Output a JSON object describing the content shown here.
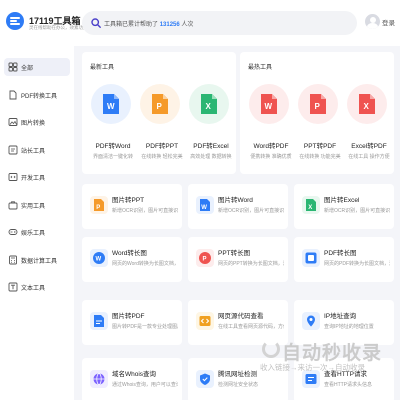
{
  "header": {
    "logo_title": "17119工具箱",
    "logo_sub": "灵在线帮助在办公，效素功搜",
    "search_prefix": "工具箱已累计帮助了",
    "search_count": "131256",
    "search_suffix": "人次",
    "login_label": "登录"
  },
  "sidebar": {
    "items": [
      {
        "label": "全部",
        "icon": "grid-icon"
      },
      {
        "label": "PDF转换工具",
        "icon": "document-icon"
      },
      {
        "label": "图片转换",
        "icon": "image-icon"
      },
      {
        "label": "站长工具",
        "icon": "tools-icon"
      },
      {
        "label": "开发工具",
        "icon": "code-icon"
      },
      {
        "label": "实用工具",
        "icon": "briefcase-icon"
      },
      {
        "label": "娱乐工具",
        "icon": "game-icon"
      },
      {
        "label": "数据计算工具",
        "icon": "calculator-icon"
      },
      {
        "label": "文本工具",
        "icon": "text-icon"
      }
    ]
  },
  "latest": {
    "title": "最新工具",
    "tools": [
      {
        "name": "PDF转Word",
        "desc": "界面清洁一键化转",
        "color": "#2e7cf6",
        "bg": "#e9f1fe",
        "letter": "W"
      },
      {
        "name": "PDF转PPT",
        "desc": "在线转换 轻松完美",
        "color": "#f59a2a",
        "bg": "#fef3e6",
        "letter": "P"
      },
      {
        "name": "PDF转Excel",
        "desc": "高效处理 数据转换",
        "color": "#2bb673",
        "bg": "#e8f7ef",
        "letter": "X"
      }
    ]
  },
  "hot": {
    "title": "最热工具",
    "tools": [
      {
        "name": "Word转PDF",
        "desc": "便携转换 准确优质",
        "color": "#ef5350",
        "bg": "#fdecec",
        "letter": "W"
      },
      {
        "name": "PPT转PDF",
        "desc": "在线转换 功能完美",
        "color": "#ef5350",
        "bg": "#fdecec",
        "letter": "P"
      },
      {
        "name": "Excel转PDF",
        "desc": "在线工具 操作方便",
        "color": "#ef5350",
        "bg": "#fdecec",
        "letter": "X"
      }
    ]
  },
  "cards": [
    {
      "title": "图片转PPT",
      "desc": "新增OCR识别，图片可直接识别",
      "color": "#f59a2a",
      "glyph": "P"
    },
    {
      "title": "图片转Word",
      "desc": "新增OCR识别，图片可直接识别",
      "color": "#2e7cf6",
      "glyph": "W"
    },
    {
      "title": "图片转Excel",
      "desc": "新增OCR识别，图片可直接识别",
      "color": "#2bb673",
      "glyph": "X"
    },
    {
      "title": "Word转长图",
      "desc": "网页的Word转换为长图文档，清晰",
      "color": "#2e7cf6",
      "glyph": "W"
    },
    {
      "title": "PPT转长图",
      "desc": "网页的PPT转换为长图文档，清晰",
      "color": "#ef5350",
      "glyph": "P"
    },
    {
      "title": "PDF转长图",
      "desc": "网页的PDF转换为长图文档，清晰",
      "color": "#2e7cf6",
      "glyph": "PDF"
    },
    {
      "title": "图片转PDF",
      "desc": "图片转PDF是一款专业处理图片",
      "color": "#2e7cf6",
      "glyph": "D"
    },
    {
      "title": "网页源代码查看",
      "desc": "在线工具查看网页源代码，方便",
      "color": "#f0a020",
      "glyph": "<>"
    },
    {
      "title": "IP地址查询",
      "desc": "查询IP地址的地理位置",
      "color": "#2e7cf6",
      "glyph": "IP"
    },
    {
      "title": "域名Whois查询",
      "desc": "通过Whois查询，用户可以查询",
      "color": "#7b61ff",
      "glyph": "W"
    },
    {
      "title": "腾讯网址检测",
      "desc": "检测网址安全状态",
      "color": "#2e7cf6",
      "glyph": "Q"
    },
    {
      "title": "查看HTTP请求",
      "desc": "查看HTTP请求头信息",
      "color": "#2e7cf6",
      "glyph": "H"
    }
  ],
  "watermark": {
    "main": "自动秒收录",
    "sub": "收入链接→来访一次→自动收录"
  }
}
